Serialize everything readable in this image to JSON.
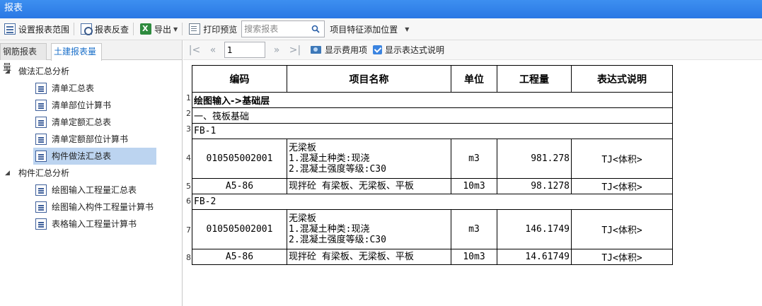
{
  "window": {
    "title": "报表"
  },
  "toolbar": {
    "set_range": "设置报表范围",
    "reverse_check": "报表反查",
    "export": "导出",
    "print_preview": "打印预览",
    "search_placeholder": "搜索报表",
    "feature_position": "项目特征添加位置"
  },
  "tabs": [
    {
      "label": "钢筋报表量"
    },
    {
      "label": "土建报表量"
    }
  ],
  "tree": {
    "group1": {
      "label": "做法汇总分析",
      "items": [
        {
          "label": "清单汇总表"
        },
        {
          "label": "清单部位计算书"
        },
        {
          "label": "清单定额汇总表"
        },
        {
          "label": "清单定额部位计算书"
        },
        {
          "label": "构件做法汇总表"
        }
      ]
    },
    "group2": {
      "label": "构件汇总分析",
      "items": [
        {
          "label": "绘图输入工程量汇总表"
        },
        {
          "label": "绘图输入构件工程量计算书"
        },
        {
          "label": "表格输入工程量计算书"
        }
      ]
    }
  },
  "nav": {
    "page": "1",
    "show_cost": "显示费用项",
    "show_expr": "显示表达式说明"
  },
  "report": {
    "headers": [
      "编码",
      "项目名称",
      "单位",
      "工程量",
      "表达式说明"
    ],
    "row_numbers": [
      "1",
      "2",
      "3",
      "4",
      "5",
      "6",
      "7",
      "8"
    ],
    "rows": [
      {
        "text": "绘图输入->基础层"
      },
      {
        "text": "一、筏板基础"
      },
      {
        "text": "FB-1"
      },
      {
        "code": "010505002001",
        "name1": "无梁板",
        "name2": "1.混凝土种类:现浇",
        "name3": "2.混凝土强度等级:C30",
        "unit": "m3",
        "qty": "981.278",
        "expr": "TJ<体积>"
      },
      {
        "code": "A5-86",
        "name": "现拌砼 有梁板、无梁板、平板",
        "unit": "10m3",
        "qty": "98.1278",
        "expr": "TJ<体积>"
      },
      {
        "text": "FB-2"
      },
      {
        "code": "010505002001",
        "name1": "无梁板",
        "name2": "1.混凝土种类:现浇",
        "name3": "2.混凝土强度等级:C30",
        "unit": "m3",
        "qty": "146.1749",
        "expr": "TJ<体积>"
      },
      {
        "code": "A5-86",
        "name": "现拌砼 有梁板、无梁板、平板",
        "unit": "10m3",
        "qty": "14.61749",
        "expr": "TJ<体积>"
      }
    ]
  }
}
